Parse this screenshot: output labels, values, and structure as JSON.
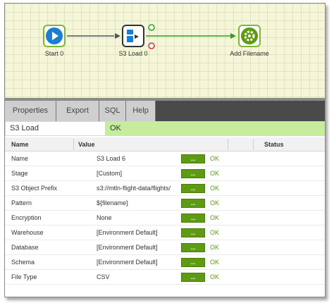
{
  "canvas": {
    "nodes": {
      "start": {
        "label": "Start 0"
      },
      "s3load": {
        "label": "S3 Load 0"
      },
      "addfilename": {
        "label": "Add Filename"
      }
    }
  },
  "tabs": [
    {
      "label": "Properties"
    },
    {
      "label": "Export"
    },
    {
      "label": "SQL"
    },
    {
      "label": "Help"
    }
  ],
  "component": {
    "name": "S3 Load",
    "status": "OK"
  },
  "table": {
    "headers": {
      "name": "Name",
      "value": "Value",
      "status": "Status"
    },
    "edit_label": "...",
    "rows": [
      {
        "name": "Name",
        "value": "S3 Load 6",
        "status": "OK"
      },
      {
        "name": "Stage",
        "value": "[Custom]",
        "status": "OK"
      },
      {
        "name": "S3 Object Prefix",
        "value": "s3://mtln-flight-data/flights/",
        "status": "OK"
      },
      {
        "name": "Pattern",
        "value": "${filename}",
        "status": "OK"
      },
      {
        "name": "Encryption",
        "value": "None",
        "status": "OK"
      },
      {
        "name": "Warehouse",
        "value": "[Environment Default]",
        "status": "OK"
      },
      {
        "name": "Database",
        "value": "[Environment Default]",
        "status": "OK"
      },
      {
        "name": "Schema",
        "value": "[Environment Default]",
        "status": "OK"
      },
      {
        "name": "File Type",
        "value": "CSV",
        "status": "OK"
      }
    ]
  },
  "colors": {
    "canvas_bg": "#f5f6d8",
    "node_border": "#7fb53a",
    "start_icon": "#1a7fd0",
    "success_connector": "#27a31e",
    "status_bar": "#c7ec9b",
    "edit_button": "#5e9a12",
    "ok_text": "#5c9a18",
    "tab_strip": "#4a4a4a"
  },
  "icons": {
    "start": "play-icon",
    "s3load": "s3-load-icon",
    "addfilename": "gear-icon"
  }
}
